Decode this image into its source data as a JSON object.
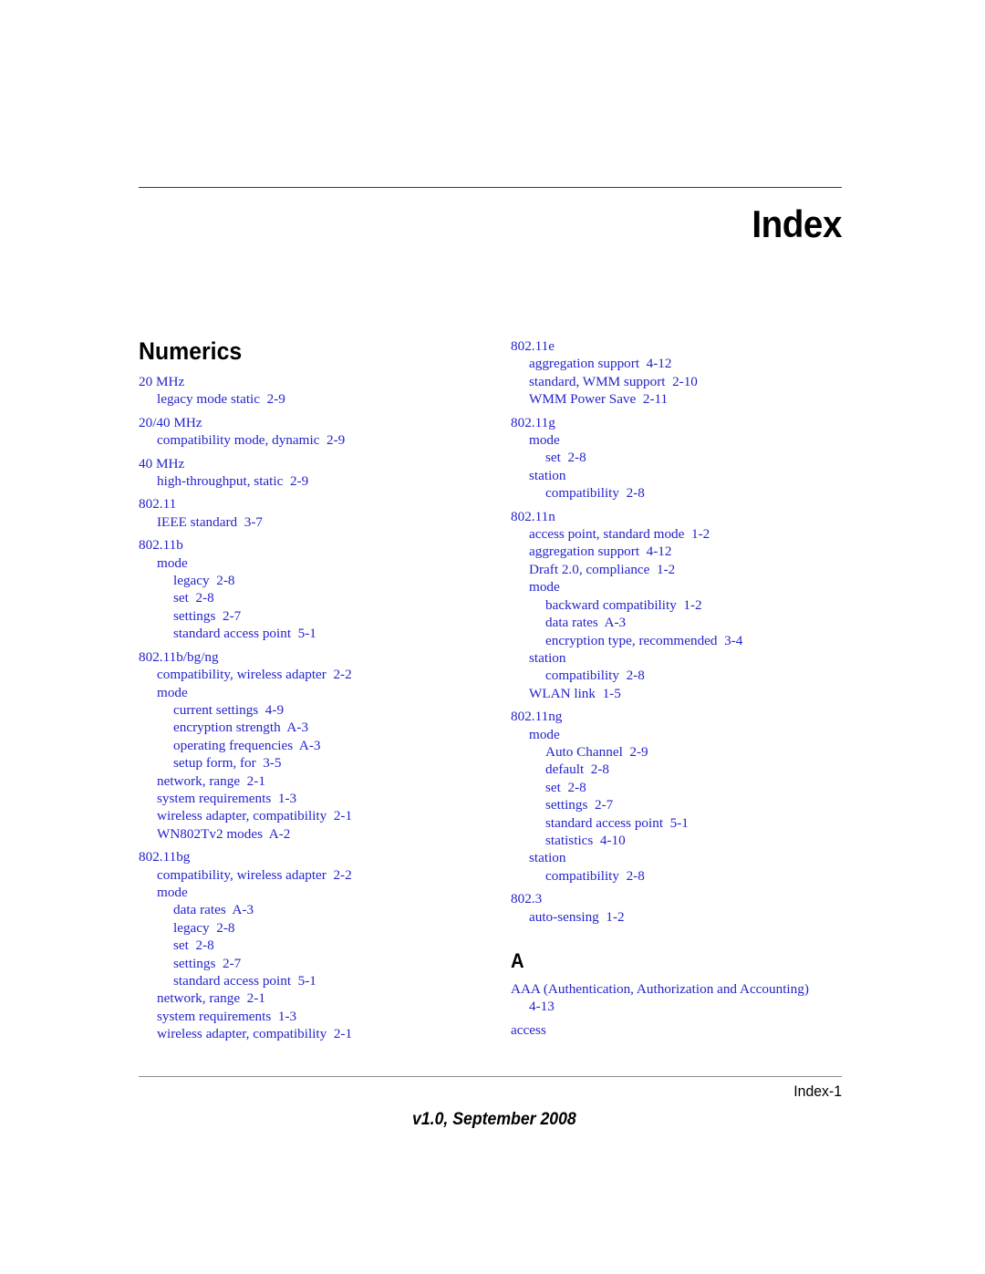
{
  "header": {
    "title": "Index"
  },
  "columns": {
    "left": {
      "letter_heading": "Numerics",
      "groups": [
        {
          "entries": [
            {
              "level": 0,
              "text": "20 MHz"
            },
            {
              "level": 1,
              "text": "legacy mode static  2-9"
            }
          ]
        },
        {
          "entries": [
            {
              "level": 0,
              "text": "20/40 MHz"
            },
            {
              "level": 1,
              "text": "compatibility mode, dynamic  2-9"
            }
          ]
        },
        {
          "entries": [
            {
              "level": 0,
              "text": "40 MHz"
            },
            {
              "level": 1,
              "text": "high-throughput, static  2-9"
            }
          ]
        },
        {
          "entries": [
            {
              "level": 0,
              "text": "802.11"
            },
            {
              "level": 1,
              "text": "IEEE standard  3-7"
            }
          ]
        },
        {
          "entries": [
            {
              "level": 0,
              "text": "802.11b"
            },
            {
              "level": 1,
              "text": "mode"
            },
            {
              "level": 2,
              "text": "legacy  2-8"
            },
            {
              "level": 2,
              "text": "set  2-8"
            },
            {
              "level": 2,
              "text": "settings  2-7"
            },
            {
              "level": 2,
              "text": "standard access point  5-1"
            }
          ]
        },
        {
          "entries": [
            {
              "level": 0,
              "text": "802.11b/bg/ng"
            },
            {
              "level": 1,
              "text": "compatibility, wireless adapter  2-2"
            },
            {
              "level": 1,
              "text": "mode"
            },
            {
              "level": 2,
              "text": "current settings  4-9"
            },
            {
              "level": 2,
              "text": "encryption strength  A-3"
            },
            {
              "level": 2,
              "text": "operating frequencies  A-3"
            },
            {
              "level": 2,
              "text": "setup form, for  3-5"
            },
            {
              "level": 1,
              "text": "network, range  2-1"
            },
            {
              "level": 1,
              "text": "system requirements  1-3"
            },
            {
              "level": 1,
              "text": "wireless adapter, compatibility  2-1"
            },
            {
              "level": 1,
              "text": "WN802Tv2 modes  A-2"
            }
          ]
        },
        {
          "entries": [
            {
              "level": 0,
              "text": "802.11bg"
            },
            {
              "level": 1,
              "text": "compatibility, wireless adapter  2-2"
            },
            {
              "level": 1,
              "text": "mode"
            },
            {
              "level": 2,
              "text": "data rates  A-3"
            },
            {
              "level": 2,
              "text": "legacy  2-8"
            },
            {
              "level": 2,
              "text": "set  2-8"
            },
            {
              "level": 2,
              "text": "settings  2-7"
            },
            {
              "level": 2,
              "text": "standard access point  5-1"
            },
            {
              "level": 1,
              "text": "network, range  2-1"
            },
            {
              "level": 1,
              "text": "system requirements  1-3"
            },
            {
              "level": 1,
              "text": "wireless adapter, compatibility  2-1"
            }
          ]
        }
      ]
    },
    "right": {
      "groups_top": [
        {
          "entries": [
            {
              "level": 0,
              "text": "802.11e"
            },
            {
              "level": 1,
              "text": "aggregation support  4-12"
            },
            {
              "level": 1,
              "text": "standard, WMM support  2-10"
            },
            {
              "level": 1,
              "text": "WMM Power Save  2-11"
            }
          ]
        },
        {
          "entries": [
            {
              "level": 0,
              "text": "802.11g"
            },
            {
              "level": 1,
              "text": "mode"
            },
            {
              "level": 2,
              "text": "set  2-8"
            },
            {
              "level": 1,
              "text": "station"
            },
            {
              "level": 2,
              "text": "compatibility  2-8"
            }
          ]
        },
        {
          "entries": [
            {
              "level": 0,
              "text": "802.11n"
            },
            {
              "level": 1,
              "text": "access point, standard mode  1-2"
            },
            {
              "level": 1,
              "text": "aggregation support  4-12"
            },
            {
              "level": 1,
              "text": "Draft 2.0, compliance  1-2"
            },
            {
              "level": 1,
              "text": "mode"
            },
            {
              "level": 2,
              "text": "backward compatibility  1-2"
            },
            {
              "level": 2,
              "text": "data rates  A-3"
            },
            {
              "level": 2,
              "text": "encryption type, recommended  3-4"
            },
            {
              "level": 1,
              "text": "station"
            },
            {
              "level": 2,
              "text": "compatibility  2-8"
            },
            {
              "level": 1,
              "text": "WLAN link  1-5"
            }
          ]
        },
        {
          "entries": [
            {
              "level": 0,
              "text": "802.11ng"
            },
            {
              "level": 1,
              "text": "mode"
            },
            {
              "level": 2,
              "text": "Auto Channel  2-9"
            },
            {
              "level": 2,
              "text": "default  2-8"
            },
            {
              "level": 2,
              "text": "set  2-8"
            },
            {
              "level": 2,
              "text": "settings  2-7"
            },
            {
              "level": 2,
              "text": "standard access point  5-1"
            },
            {
              "level": 2,
              "text": "statistics  4-10"
            },
            {
              "level": 1,
              "text": "station"
            },
            {
              "level": 2,
              "text": "compatibility  2-8"
            }
          ]
        },
        {
          "entries": [
            {
              "level": 0,
              "text": "802.3"
            },
            {
              "level": 1,
              "text": "auto-sensing  1-2"
            }
          ]
        }
      ],
      "letter_heading": "A",
      "groups_bottom": [
        {
          "entries": [
            {
              "level": 0,
              "text": "AAA (Authentication, Authorization and Accounting)"
            },
            {
              "level": 1,
              "text": "4-13"
            }
          ]
        },
        {
          "entries": [
            {
              "level": 0,
              "text": "access"
            }
          ]
        }
      ]
    }
  },
  "footer": {
    "folio": "Index-1",
    "version": "v1.0, September 2008"
  }
}
